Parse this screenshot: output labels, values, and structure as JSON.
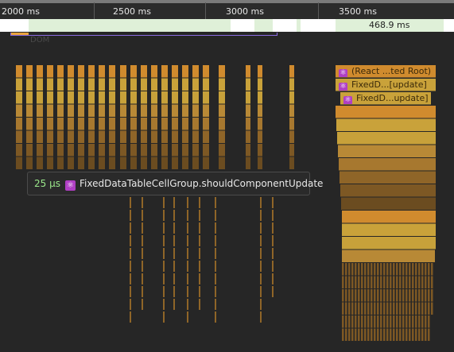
{
  "ruler": {
    "labels": [
      "2000 ms",
      "2500 ms",
      "3000 ms",
      "3500 ms"
    ]
  },
  "track": {
    "duration_label": "468.9 ms"
  },
  "flame": {
    "labels": [
      "(React ...ted Root)",
      "FixedD...[update]",
      "FixedD...update]"
    ],
    "icon": "react-atom-icon"
  },
  "tooltip": {
    "time": "25 µs",
    "name": "FixedDataTableCellGroup.shouldComponentUpdate",
    "icon": "react-atom-icon"
  },
  "colors": {
    "accent": "#8a6be0",
    "track": "#dff0d8",
    "react_icon": "#b03fc4",
    "tooltip_time": "#9be88b"
  }
}
